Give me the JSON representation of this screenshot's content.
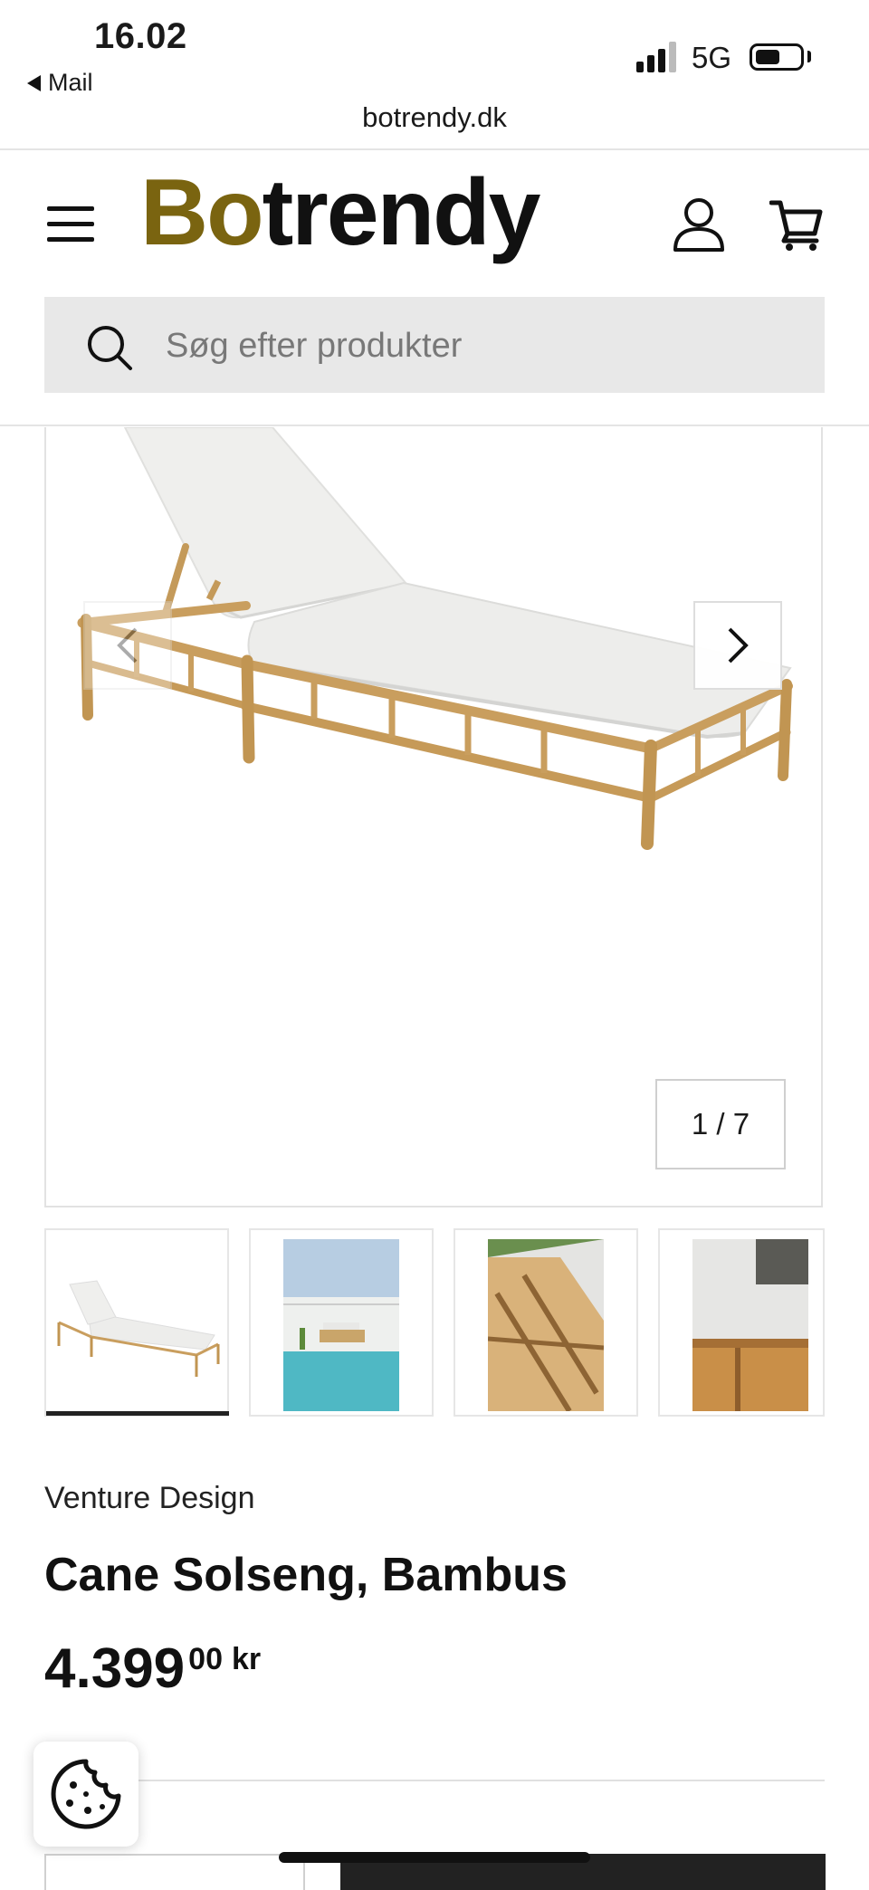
{
  "status_bar": {
    "time": "16.02",
    "back_app": "Mail",
    "network": "5G",
    "url": "botrendy.dk"
  },
  "header": {
    "logo_part1": "Bo",
    "logo_part2": "trendy",
    "icons": [
      "menu-icon",
      "user-icon",
      "cart-icon"
    ]
  },
  "search": {
    "placeholder": "Søg efter produkter"
  },
  "gallery": {
    "counter": "1 / 7",
    "thumbnails": [
      "Cane Solseng front",
      "Poolside setting",
      "Backrest closeup",
      "Cushion detail"
    ]
  },
  "product": {
    "brand": "Venture Design",
    "title": "Cane Solseng, Bambus",
    "price_main": "4.399",
    "price_decimals": "00",
    "currency": "kr"
  },
  "colors": {
    "logo_accent": "#7a6410",
    "text": "#111111",
    "search_bg": "#e8e8e8"
  }
}
